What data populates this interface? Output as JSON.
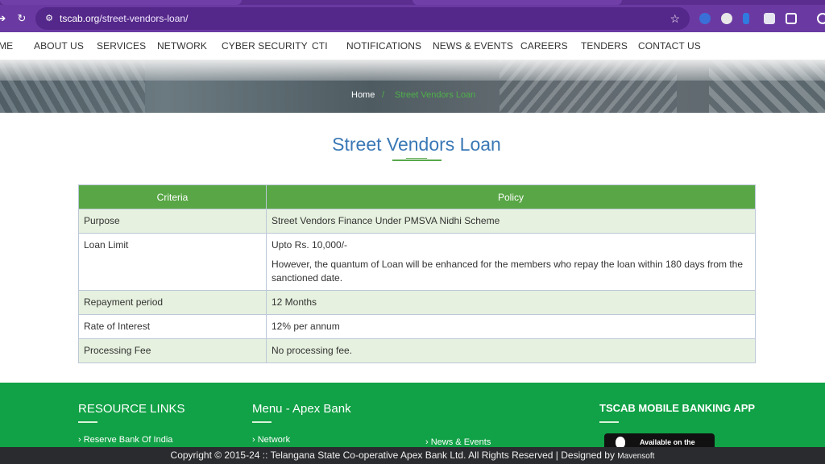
{
  "browser": {
    "url_domain": "tscab.org",
    "url_path": "/street-vendors-loan/"
  },
  "nav": {
    "items": [
      "ME",
      "ABOUT US",
      "SERVICES",
      "NETWORK",
      "CYBER SECURITY",
      "CTI",
      "NOTIFICATIONS",
      "NEWS & EVENTS",
      "CAREERS",
      "TENDERS",
      "CONTACT US"
    ]
  },
  "breadcrumb": {
    "home": "Home",
    "separator": "/",
    "current": "Street Vendors Loan"
  },
  "page": {
    "title": "Street Vendors Loan"
  },
  "table": {
    "headers": [
      "Criteria",
      "Policy"
    ],
    "rows": [
      {
        "criteria": "Purpose",
        "policy": "Street Vendors Finance Under PMSVA Nidhi Scheme",
        "note": ""
      },
      {
        "criteria": "Loan Limit",
        "policy": "Upto Rs. 10,000/-",
        "note": "However, the quantum of Loan will be enhanced for the members who repay the loan within 180 days from the sanctioned date."
      },
      {
        "criteria": "Repayment period",
        "policy": "12 Months",
        "note": ""
      },
      {
        "criteria": "Rate of Interest",
        "policy": "12% per annum",
        "note": ""
      },
      {
        "criteria": "Processing Fee",
        "policy": "No processing fee.",
        "note": ""
      }
    ]
  },
  "footer": {
    "resource_title": "RESOURCE LINKS",
    "resource_link": "Reserve Bank Of India",
    "menu_title": "Menu - Apex Bank",
    "menu_link": "Network",
    "news_link": "News & Events",
    "app_title": "TSCAB MOBILE BANKING APP",
    "app_badge": "Available on the",
    "copyright": "Copyright © 2015-24 :: Telangana State Co-operative Apex Bank Ltd. All Rights Reserved | Designed by",
    "designer": "Mavensoft"
  },
  "colors": {
    "accent_green": "#58a645",
    "footer_green": "#11a146",
    "title_blue": "#3a78b5",
    "browser_purple": "#6a3aa2"
  }
}
